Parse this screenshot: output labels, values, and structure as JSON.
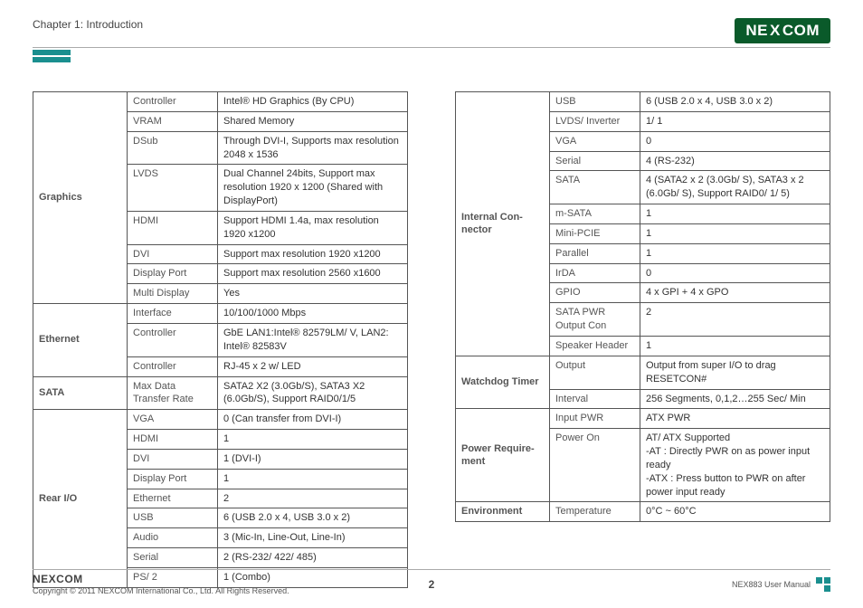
{
  "header": {
    "chapter": "Chapter 1: Introduction",
    "logo_name": "NE",
    "logo_x": "X",
    "logo_tail": "COM"
  },
  "left_table": [
    {
      "cat": "Graphics",
      "rows": [
        {
          "k": "Controller",
          "v": "Intel® HD Graphics (By CPU)"
        },
        {
          "k": "VRAM",
          "v": "Shared Memory"
        },
        {
          "k": "DSub",
          "v": "Through DVI-I, Supports max resolution 2048 x 1536"
        },
        {
          "k": "LVDS",
          "v": "Dual Channel 24bits, Support max resolution 1920 x 1200 (Shared with DisplayPort)"
        },
        {
          "k": "HDMI",
          "v": "Support HDMI 1.4a, max resolution 1920 x1200"
        },
        {
          "k": "DVI",
          "v": "Support max resolution 1920 x1200"
        },
        {
          "k": "Display Port",
          "v": "Support max resolution 2560 x1600"
        },
        {
          "k": "Multi Display",
          "v": "Yes"
        }
      ]
    },
    {
      "cat": "Ethernet",
      "rows": [
        {
          "k": "Interface",
          "v": "10/100/1000 Mbps"
        },
        {
          "k": "Controller",
          "v": "GbE LAN1:Intel® 82579LM/ V, LAN2: Intel® 82583V"
        },
        {
          "k": "Controller",
          "v": "RJ-45 x 2 w/ LED"
        }
      ]
    },
    {
      "cat": "SATA",
      "rows": [
        {
          "k": "Max Data Transfer Rate",
          "v": "SATA2 X2 (3.0Gb/S), SATA3 X2 (6.0Gb/S), Support RAID0/1/5"
        }
      ]
    },
    {
      "cat": "Rear I/O",
      "rows": [
        {
          "k": "VGA",
          "v": "0 (Can transfer from DVI-I)"
        },
        {
          "k": "HDMI",
          "v": "1"
        },
        {
          "k": "DVI",
          "v": "1 (DVI-I)"
        },
        {
          "k": "Display Port",
          "v": "1"
        },
        {
          "k": "Ethernet",
          "v": "2"
        },
        {
          "k": "USB",
          "v": "6 (USB 2.0 x 4, USB 3.0 x 2)"
        },
        {
          "k": "Audio",
          "v": "3 (Mic-In, Line-Out, Line-In)"
        },
        {
          "k": "Serial",
          "v": "2 (RS-232/ 422/ 485)"
        },
        {
          "k": "PS/ 2",
          "v": "1 (Combo)"
        }
      ]
    }
  ],
  "right_table": [
    {
      "cat": "Internal Con­nector",
      "rows": [
        {
          "k": "USB",
          "v": "6 (USB 2.0 x 4, USB 3.0 x 2)"
        },
        {
          "k": "LVDS/ Inverter",
          "v": "1/ 1"
        },
        {
          "k": "VGA",
          "v": "0"
        },
        {
          "k": "Serial",
          "v": "4 (RS-232)"
        },
        {
          "k": "SATA",
          "v": "4 (SATA2 x 2 (3.0Gb/ S), SATA3 x 2 (6.0Gb/ S), Support RAID0/ 1/ 5)"
        },
        {
          "k": "m-SATA",
          "v": "1"
        },
        {
          "k": "Mini-PCIE",
          "v": "1"
        },
        {
          "k": "Parallel",
          "v": "1"
        },
        {
          "k": "IrDA",
          "v": "0"
        },
        {
          "k": "GPIO",
          "v": "4 x GPI + 4 x GPO"
        },
        {
          "k": "SATA PWR Output Con",
          "v": "2"
        },
        {
          "k": "Speaker Header",
          "v": "1"
        }
      ]
    },
    {
      "cat": "Watchdog Timer",
      "rows": [
        {
          "k": "Output",
          "v": "Output from super I/O to drag RESETCON#"
        },
        {
          "k": "Interval",
          "v": "256 Segments, 0,1,2…255 Sec/ Min"
        }
      ]
    },
    {
      "cat": "Power Require­ment",
      "rows": [
        {
          "k": "Input PWR",
          "v": "ATX PWR"
        },
        {
          "k": "Power On",
          "v": "AT/ ATX Supported\n-AT : Directly PWR on as power input ready\n-ATX : Press button to PWR on after power input ready"
        }
      ]
    },
    {
      "cat": "Environment",
      "rows": [
        {
          "k": "Temperature",
          "v": "0°C ~ 60°C"
        }
      ]
    }
  ],
  "footer": {
    "logo": "NEXCOM",
    "copyright": "Copyright © 2011 NEXCOM International Co., Ltd. All Rights Reserved.",
    "page": "2",
    "doc": "NEX883 User Manual"
  }
}
